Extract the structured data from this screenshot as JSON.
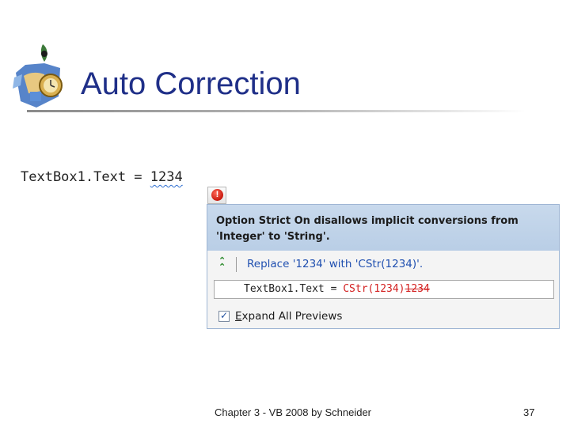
{
  "slide": {
    "title": "Auto Correction",
    "footer": "Chapter 3 - VB 2008 by Schneider",
    "page_number": "37"
  },
  "editor": {
    "code_prefix": "TextBox1.Text = ",
    "code_value": "1234"
  },
  "smart_tag": {
    "error_icon": "error-icon",
    "message": "Option Strict On disallows implicit conversions from 'Integer' to 'String'.",
    "fix_icon": "double-chevron-up-icon",
    "fix_label": "Replace '1234' with 'CStr(1234)'.",
    "preview_prefix": "TextBox1.Text = ",
    "preview_inserted": "CStr(1234)",
    "preview_deleted": "1234",
    "expand_checked": true,
    "expand_label_accel": "E",
    "expand_label_rest": "xpand All Previews"
  },
  "colors": {
    "title": "#1f2f88",
    "popup_header": "#c8d9ec",
    "link": "#1f4fb0",
    "error": "#d32020"
  }
}
